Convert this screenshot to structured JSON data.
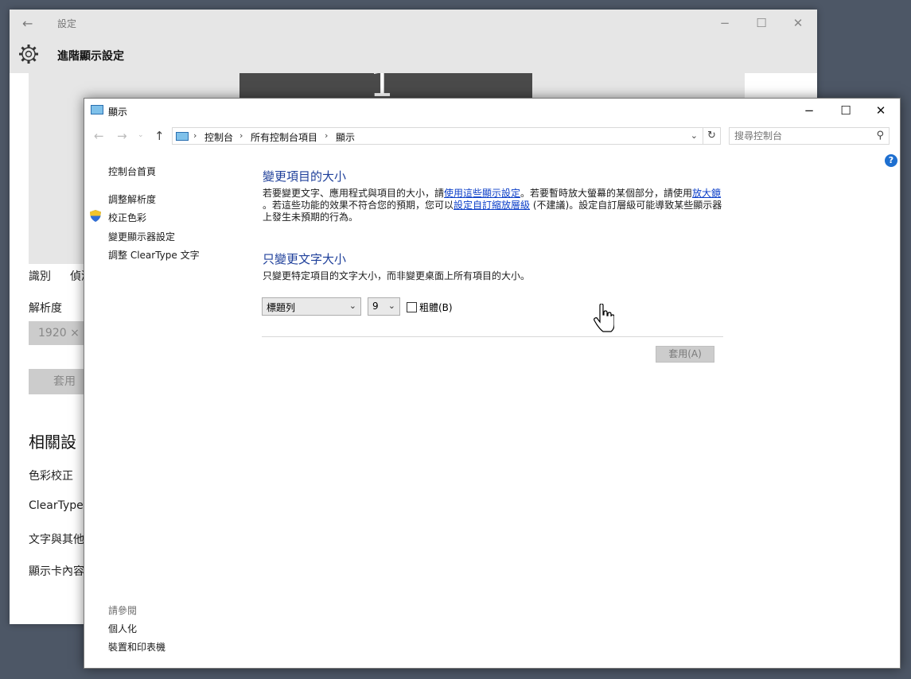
{
  "background_window": {
    "app_title": "設定",
    "page_title": "進階顯示設定",
    "monitor_number": "1",
    "tabs": [
      "識別",
      "偵測"
    ],
    "resolution_label": "解析度",
    "resolution_value": "1920 ×",
    "apply_label": "套用",
    "related_heading": "相關設",
    "related_links": [
      "色彩校正",
      "ClearType",
      "文字與其他",
      "顯示卡內容"
    ]
  },
  "window": {
    "title": "顯示"
  },
  "navigation": {
    "breadcrumbs": [
      "控制台",
      "所有控制台項目",
      "顯示"
    ],
    "search_placeholder": "搜尋控制台"
  },
  "sidebar": {
    "home": "控制台首頁",
    "items": [
      "調整解析度",
      "校正色彩",
      "變更顯示器設定",
      "調整 ClearType 文字"
    ],
    "see_also_label": "請參閱",
    "see_also": [
      "個人化",
      "裝置和印表機"
    ]
  },
  "main": {
    "section1_title": "變更項目的大小",
    "section1_text": {
      "p1": "若要變更文字、應用程式與項目的大小，請",
      "link1": "使用這些顯示設定",
      "p2": "。若要暫時放大螢幕的某個部分，請使用",
      "link2": "放大鏡",
      "p3": "。若這些功能的效果不符合您的預期，您可以",
      "link3": "設定自訂縮放層級",
      "p4": " (不建議)。設定自訂層級可能導致某些顯示器",
      "p5": "上發生未預期的行為。"
    },
    "section2_title": "只變更文字大小",
    "section2_text": "只變更特定項目的文字大小，而非變更桌面上所有項目的大小。",
    "font_item_select": "標題列",
    "font_size_select": "9",
    "bold_label": "粗體(B)",
    "bold_checked": false,
    "apply_label": "套用(A)"
  },
  "colors": {
    "link": "#0b3ec8",
    "heading": "#1e3f9a",
    "desktop": "#4d5766"
  },
  "icons": [
    "gear-icon",
    "display-icon",
    "shield-icon",
    "help-icon",
    "search-icon",
    "refresh-icon",
    "hand-cursor-icon"
  ]
}
